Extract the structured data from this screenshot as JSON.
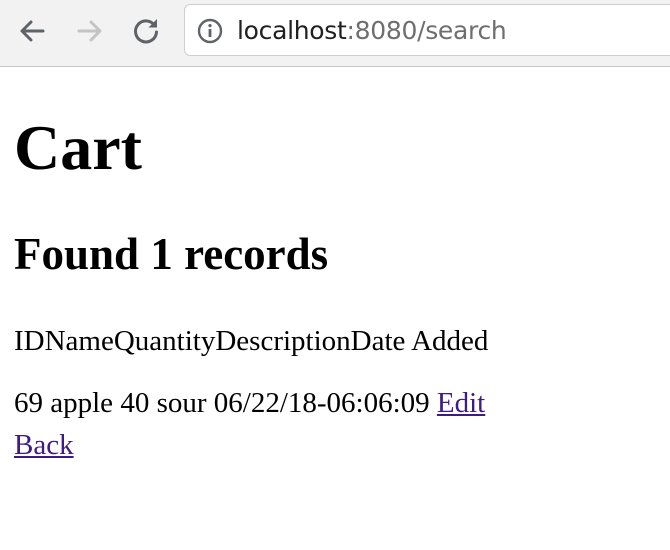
{
  "browser": {
    "back_icon": "arrow-left-icon",
    "forward_icon": "arrow-right-icon",
    "reload_icon": "reload-icon",
    "info_icon": "info-circle-icon",
    "url_host": "localhost",
    "url_rest": ":8080/search"
  },
  "page": {
    "title": "Cart",
    "results_heading": "Found 1 records",
    "table": {
      "headers": [
        "ID",
        "Name",
        "Quantity",
        "Description",
        "Date Added"
      ],
      "rows": [
        {
          "id": "69",
          "name": "apple",
          "quantity": "40",
          "description": "sour",
          "date_added": "06/22/18-06:06:09",
          "edit_label": "Edit"
        }
      ]
    },
    "back_label": "Back"
  },
  "colors": {
    "toolbar_bg": "#f2f2f2",
    "link": "#3d1a86",
    "url_rest": "#6e6e6e"
  }
}
